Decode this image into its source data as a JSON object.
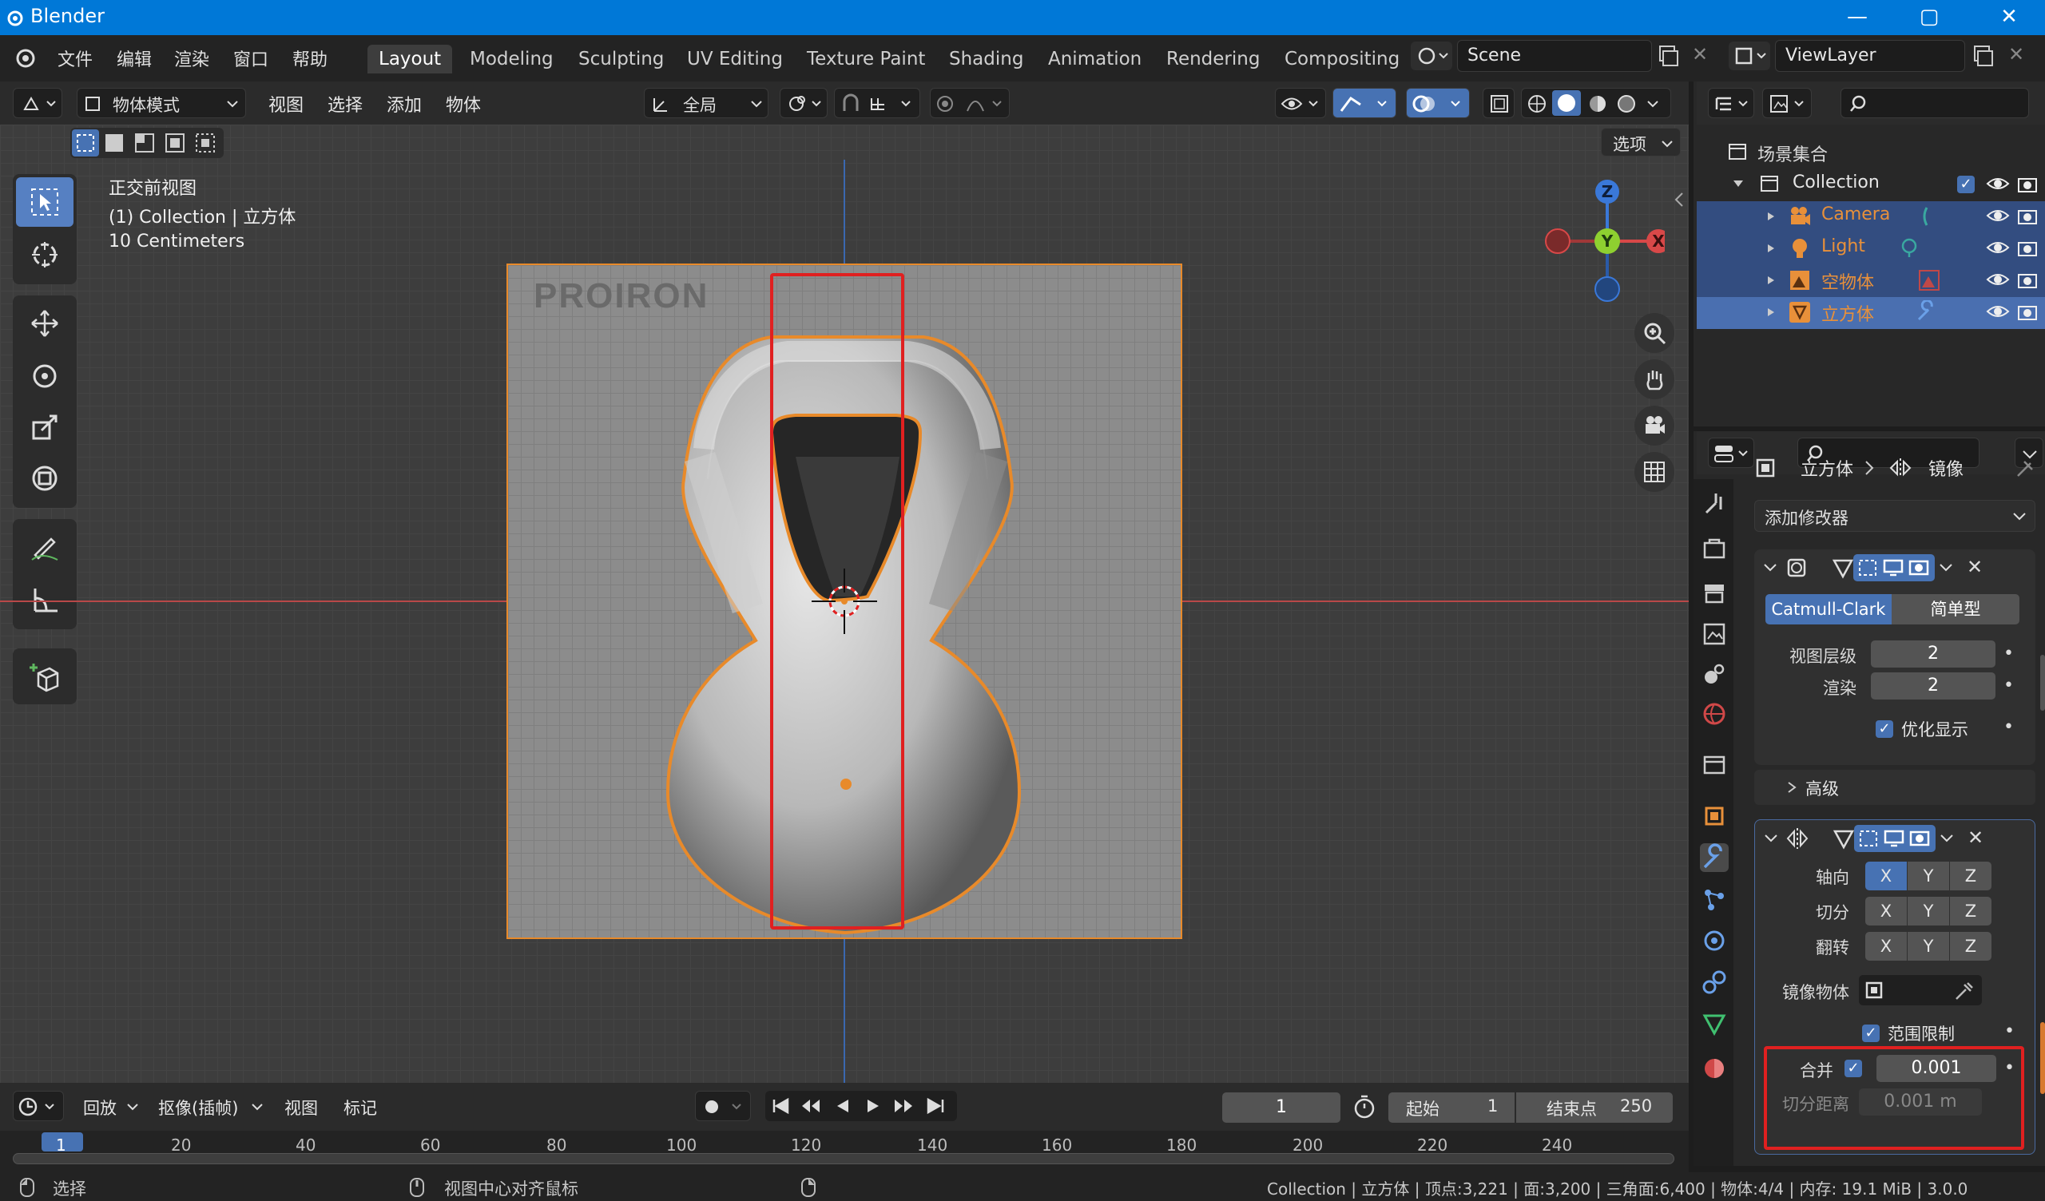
{
  "window": {
    "title": "Blender",
    "minimize": "—",
    "maximize": "▢",
    "close": "✕"
  },
  "menu": [
    "文件",
    "编辑",
    "渲染",
    "窗口",
    "帮助"
  ],
  "workspaces": [
    "Layout",
    "Modeling",
    "Sculpting",
    "UV Editing",
    "Texture Paint",
    "Shading",
    "Animation",
    "Rendering",
    "Compositing"
  ],
  "scene": "Scene",
  "view_layer": "ViewLayer",
  "viewport_header": {
    "mode": "物体模式",
    "menus": [
      "视图",
      "选择",
      "添加",
      "物体"
    ],
    "transform_orientation": "全局",
    "options": "选项"
  },
  "viewport": {
    "view_name": "正交前视图",
    "collection_info": "(1) Collection | 立方体",
    "scale": "10 Centimeters",
    "watermark": "PROIRON",
    "gizmo": {
      "z": "Z",
      "y": "Y",
      "x": "X"
    }
  },
  "outliner": {
    "root": "场景集合",
    "collection": "Collection",
    "items": [
      {
        "name": "Camera",
        "color": "#e8903a"
      },
      {
        "name": "Light",
        "color": "#e8903a"
      },
      {
        "name": "空物体",
        "color": "#e8903a"
      },
      {
        "name": "立方体",
        "color": "#e8903a"
      }
    ]
  },
  "properties": {
    "breadcrumb_object": "立方体",
    "breadcrumb_modifier": "镜像",
    "add_modifier": "添加修改器",
    "subsurf": {
      "mode_catmull": "Catmull-Clark",
      "mode_simple": "简单型",
      "viewport_levels_label": "视图层级",
      "viewport_levels": "2",
      "render_label": "渲染",
      "render": "2",
      "optimal_display": "优化显示",
      "advanced": "高级"
    },
    "mirror": {
      "axis_label": "轴向",
      "bisect_label": "切分",
      "flip_label": "翻转",
      "x": "X",
      "y": "Y",
      "z": "Z",
      "mirror_object_label": "镜像物体",
      "clipping": "范围限制",
      "merge_label": "合并",
      "merge_value": "0.001",
      "bisect_distance_label": "切分距离",
      "bisect_distance_value": "0.001 m"
    }
  },
  "timeline": {
    "playback": "回放",
    "keying": "抠像(插帧)",
    "view": "视图",
    "marker": "标记",
    "current_frame": "1",
    "start_label": "起始",
    "start": "1",
    "end_label": "结束点",
    "end": "250",
    "ticks": [
      "1",
      "20",
      "40",
      "60",
      "80",
      "100",
      "120",
      "140",
      "160",
      "180",
      "200",
      "220",
      "240"
    ]
  },
  "status": {
    "select": "选择",
    "center": "视图中心对齐鼠标",
    "stats": "Collection | 立方体 | 顶点:3,221 | 面:3,200 | 三角面:6,400 | 物体:4/4 | 内存: 19.1 MiB | 3.0.0"
  },
  "colors": {
    "accent": "#4772b3",
    "selected": "#e8903a",
    "highlight": "#e02020"
  }
}
